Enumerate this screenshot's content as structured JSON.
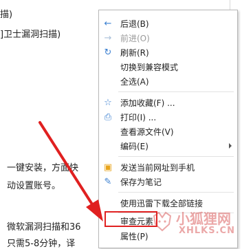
{
  "page": {
    "lines": [
      "描)",
      "]卫士漏洞扫描)",
      "一键安装，方面快",
      "动设置账号。",
      "微软漏洞扫描和36",
      "只需5-8分钟，译"
    ]
  },
  "menu": {
    "items": [
      {
        "label": "后退(B)",
        "icon": "back-arrow-icon",
        "glyph": "←",
        "disabled": false
      },
      {
        "label": "前进(O)",
        "icon": "forward-arrow-icon",
        "glyph": "→",
        "disabled": true
      },
      {
        "label": "刷新(R)",
        "icon": "refresh-icon",
        "glyph": "↻",
        "disabled": false
      },
      {
        "label": "切换到兼容模式",
        "icon": "",
        "glyph": "",
        "disabled": false
      },
      {
        "label": "全选(A)",
        "icon": "",
        "glyph": "",
        "disabled": false
      },
      {
        "label": "添加收藏(F) ...",
        "icon": "star-add-icon",
        "glyph": "☆",
        "disabled": false
      },
      {
        "label": "打印(I) ...",
        "icon": "printer-icon",
        "glyph": "⎙",
        "disabled": false
      },
      {
        "label": "查看源文件(V)",
        "icon": "",
        "glyph": "",
        "disabled": false
      },
      {
        "label": "编码(E)",
        "icon": "",
        "glyph": "",
        "disabled": false,
        "submenu": true
      },
      {
        "label": "发送当前网址到手机",
        "icon": "send-to-phone-icon",
        "glyph": "▣",
        "disabled": false
      },
      {
        "label": "保存为笔记",
        "icon": "note-edit-icon",
        "glyph": "✎",
        "disabled": false
      },
      {
        "label": "使用迅雷下载全部链接",
        "icon": "",
        "glyph": "",
        "disabled": false
      },
      {
        "label": "审查元素",
        "icon": "",
        "glyph": "",
        "disabled": false,
        "highlighted": true
      },
      {
        "label": "属性(P)",
        "icon": "",
        "glyph": "",
        "disabled": false
      }
    ]
  },
  "watermark": {
    "text_cn": "小狐狸网",
    "text_en": "XHLKS.CN",
    "logo": "fox-logo-icon"
  },
  "colors": {
    "highlight": "#e02020",
    "arrow": "#e02020",
    "icon_blue": "#3a7fd0"
  }
}
